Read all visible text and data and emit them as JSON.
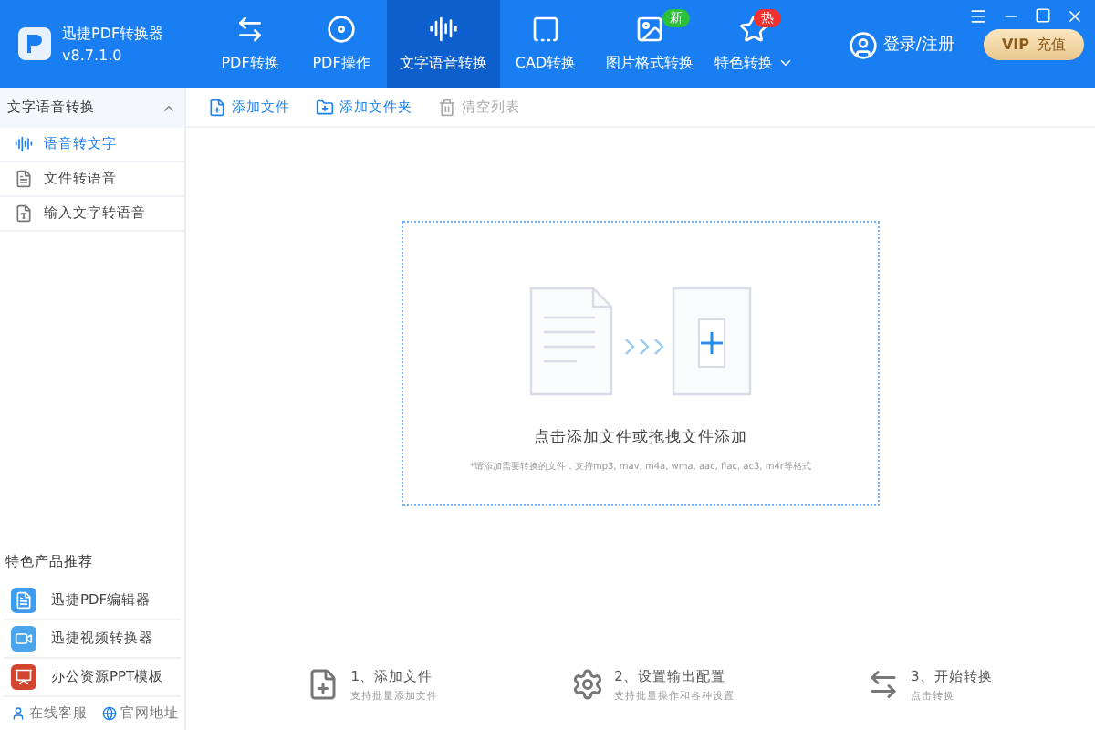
{
  "app": {
    "name": "迅捷PDF转换器",
    "version": "v8.7.1.0"
  },
  "nav": [
    {
      "label": "PDF转换",
      "selected": false
    },
    {
      "label": "PDF操作",
      "selected": false
    },
    {
      "label": "文字语音转换",
      "selected": true
    },
    {
      "label": "CAD转换",
      "selected": false
    },
    {
      "label": "图片格式转换",
      "selected": false,
      "badge": {
        "text": "新",
        "color": "#2bbf3a"
      }
    },
    {
      "label": "特色转换",
      "selected": false,
      "dropdown": true,
      "badge": {
        "text": "热",
        "color": "#f0312f"
      }
    }
  ],
  "login": "登录/注册",
  "vip": {
    "brand": "VIP",
    "text": "充值"
  },
  "sidebar": {
    "group": {
      "title": "文字语音转换",
      "expanded": true
    },
    "items": [
      {
        "label": "语音转文字",
        "selected": true
      },
      {
        "label": "文件转语音",
        "selected": false
      },
      {
        "label": "输入文字转语音",
        "selected": false
      }
    ],
    "promo_title": "特色产品推荐",
    "products": [
      {
        "label": "迅捷PDF编辑器"
      },
      {
        "label": "迅捷视频转换器"
      },
      {
        "label": "办公资源PPT模板"
      }
    ],
    "links": [
      {
        "label": "在线客服"
      },
      {
        "label": "官网地址"
      }
    ]
  },
  "toolbar": [
    {
      "label": "添加文件",
      "disabled": false
    },
    {
      "label": "添加文件夹",
      "disabled": false
    },
    {
      "label": "清空列表",
      "disabled": true
    }
  ],
  "dropzone": {
    "title": "点击添加文件或拖拽文件添加",
    "hint": "*请添加需要转换的文件，支持mp3, mav, m4a, wma, aac, flac, ac3, m4r等格式"
  },
  "steps": [
    {
      "title": "1、添加文件",
      "subtitle": "支持批量添加文件"
    },
    {
      "title": "2、设置输出配置",
      "subtitle": "支持批量操作和各种设置"
    },
    {
      "title": "3、开始转换",
      "subtitle": "点击转换"
    }
  ]
}
